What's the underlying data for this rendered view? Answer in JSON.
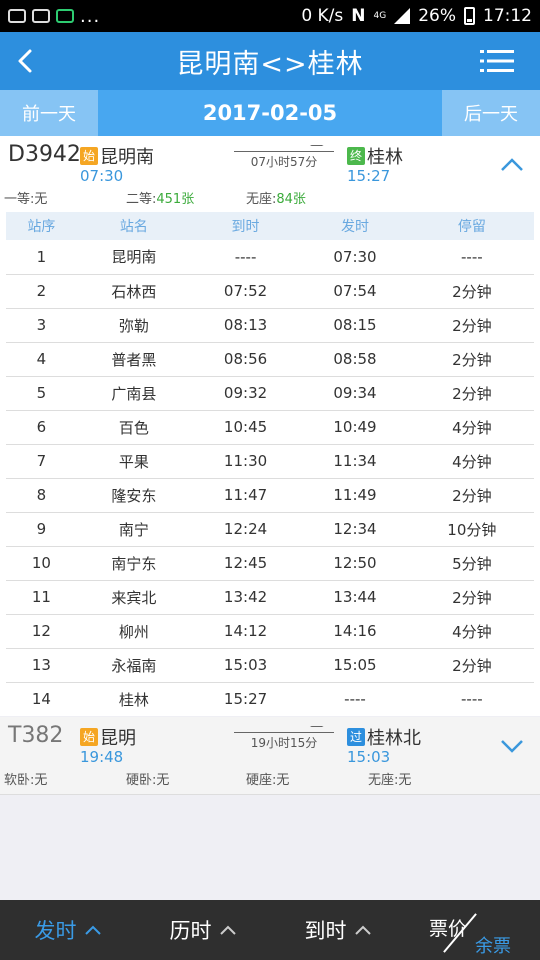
{
  "status_bar": {
    "speed": "0 K/s",
    "net": "4G",
    "battery": "26%",
    "time": "17:12",
    "dots": "..."
  },
  "header": {
    "title": "昆明南<>桂林"
  },
  "date_bar": {
    "prev": "前一天",
    "date": "2017-02-05",
    "next": "后一天"
  },
  "train1": {
    "code": "D3942",
    "from_tag": "始",
    "from": "昆明南",
    "depart": "07:30",
    "duration": "07小时57分",
    "to_tag": "终",
    "to": "桂林",
    "arrive": "15:27",
    "seat1": "一等:无",
    "seat2_label": "二等:",
    "seat2_value": "451张",
    "seat3_label": "无座:",
    "seat3_value": "84张"
  },
  "table": {
    "headers": [
      "站序",
      "站名",
      "到时",
      "发时",
      "停留"
    ],
    "rows": [
      [
        "1",
        "昆明南",
        "----",
        "07:30",
        "----"
      ],
      [
        "2",
        "石林西",
        "07:52",
        "07:54",
        "2分钟"
      ],
      [
        "3",
        "弥勒",
        "08:13",
        "08:15",
        "2分钟"
      ],
      [
        "4",
        "普者黑",
        "08:56",
        "08:58",
        "2分钟"
      ],
      [
        "5",
        "广南县",
        "09:32",
        "09:34",
        "2分钟"
      ],
      [
        "6",
        "百色",
        "10:45",
        "10:49",
        "4分钟"
      ],
      [
        "7",
        "平果",
        "11:30",
        "11:34",
        "4分钟"
      ],
      [
        "8",
        "隆安东",
        "11:47",
        "11:49",
        "2分钟"
      ],
      [
        "9",
        "南宁",
        "12:24",
        "12:34",
        "10分钟"
      ],
      [
        "10",
        "南宁东",
        "12:45",
        "12:50",
        "5分钟"
      ],
      [
        "11",
        "来宾北",
        "13:42",
        "13:44",
        "2分钟"
      ],
      [
        "12",
        "柳州",
        "14:12",
        "14:16",
        "4分钟"
      ],
      [
        "13",
        "永福南",
        "15:03",
        "15:05",
        "2分钟"
      ],
      [
        "14",
        "桂林",
        "15:27",
        "----",
        "----"
      ]
    ]
  },
  "train2": {
    "code": "T382",
    "from_tag": "始",
    "from": "昆明",
    "depart": "19:48",
    "duration": "19小时15分",
    "to_tag": "过",
    "to": "桂林北",
    "arrive": "15:03",
    "seat1": "软卧:无",
    "seat2": "硬卧:无",
    "seat3": "硬座:无",
    "seat4": "无座:无"
  },
  "bottom_bar": {
    "depart": "发时",
    "duration": "历时",
    "arrive": "到时",
    "price": "票价",
    "remaining": "余票"
  },
  "colors": {
    "header": "#2d8fde",
    "date_bar": "#48a7f0",
    "accent": "#3a97dc",
    "green": "#3cab3c",
    "orange": "#f5a623"
  }
}
